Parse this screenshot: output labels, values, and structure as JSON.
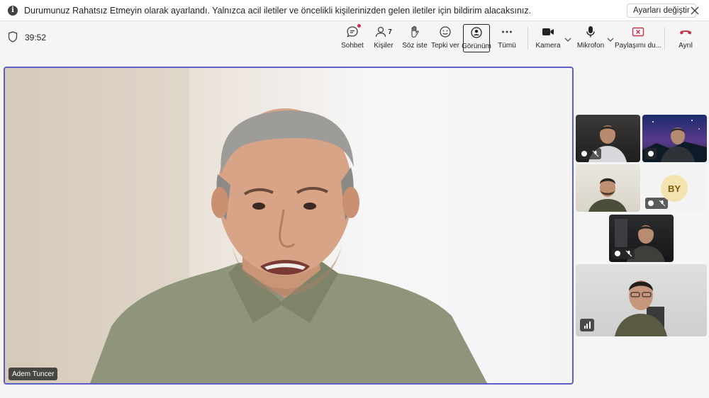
{
  "notification": {
    "message": "Durumunuz Rahatsız Etmeyin olarak ayarlandı. Yalnızca acil iletiler ve öncelikli kişilerinizden gelen iletiler için bildirim alacaksınız.",
    "settings_button": "Ayarları değiştir"
  },
  "meeting": {
    "timer": "39:52"
  },
  "toolbar": {
    "chat": "Sohbet",
    "people": "Kişiler",
    "people_count": "7",
    "raise_hand": "Söz iste",
    "react": "Tepki ver",
    "view": "Görünüm",
    "more": "Tümü",
    "camera": "Kamera",
    "mic": "Mikrofon",
    "share": "Paylaşımı du...",
    "leave": "Ayrıl"
  },
  "main_video": {
    "speaker_name": "Adem Tuncer"
  },
  "participants": [
    {
      "initials": ""
    },
    {
      "initials": ""
    },
    {
      "initials": ""
    },
    {
      "initials": "BY"
    },
    {
      "initials": ""
    },
    {
      "initials": ""
    }
  ],
  "colors": {
    "accent": "#5b5fc7",
    "leave": "#c4314b",
    "share_icon": "#c4314b"
  }
}
